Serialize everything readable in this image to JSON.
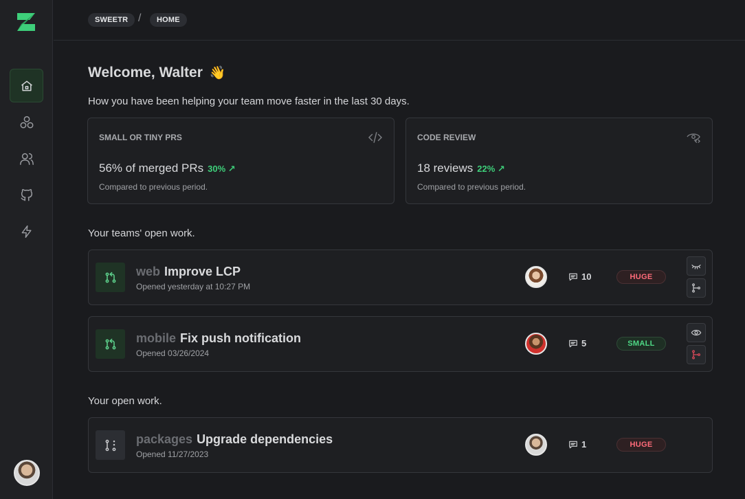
{
  "app": {
    "name": "SWEETR",
    "accent": "#3ecf7a"
  },
  "sidebar": {
    "items": [
      {
        "icon": "home-icon",
        "active": true
      },
      {
        "icon": "teams-icon",
        "active": false
      },
      {
        "icon": "people-icon",
        "active": false
      },
      {
        "icon": "github-icon",
        "active": false
      },
      {
        "icon": "lightning-icon",
        "active": false
      }
    ]
  },
  "breadcrumb": {
    "items": [
      "SWEETR",
      "HOME"
    ],
    "separator": "/"
  },
  "header": {
    "welcome": "Welcome, Walter",
    "wave": "👋",
    "subtitle": "How you have been helping your team move faster in the last 30 days."
  },
  "stats": [
    {
      "title": "SMALL OR TINY PRS",
      "value": "56% of merged PRs",
      "delta": "30% ↗",
      "note": "Compared to previous period.",
      "icon": "code-icon"
    },
    {
      "title": "CODE REVIEW",
      "value": "18 reviews",
      "delta": "22% ↗",
      "note": "Compared to previous period.",
      "icon": "eye-code-icon"
    }
  ],
  "sections": {
    "team_open_work": "Your teams' open work.",
    "your_open_work": "Your open work."
  },
  "team_prs": [
    {
      "repo": "web",
      "title": "Improve LCP",
      "opened": "Opened yesterday at 10:27 PM",
      "comments": "10",
      "size": "HUGE",
      "size_color": "#ff6b7a"
    },
    {
      "repo": "mobile",
      "title": "Fix push notification",
      "opened": "Opened 03/26/2024",
      "comments": "5",
      "size": "SMALL",
      "size_color": "#4ed985"
    }
  ],
  "my_prs": [
    {
      "repo": "packages",
      "title": "Upgrade dependencies",
      "opened": "Opened 11/27/2023",
      "comments": "1",
      "size": "HUGE",
      "size_color": "#ff6b7a"
    }
  ]
}
